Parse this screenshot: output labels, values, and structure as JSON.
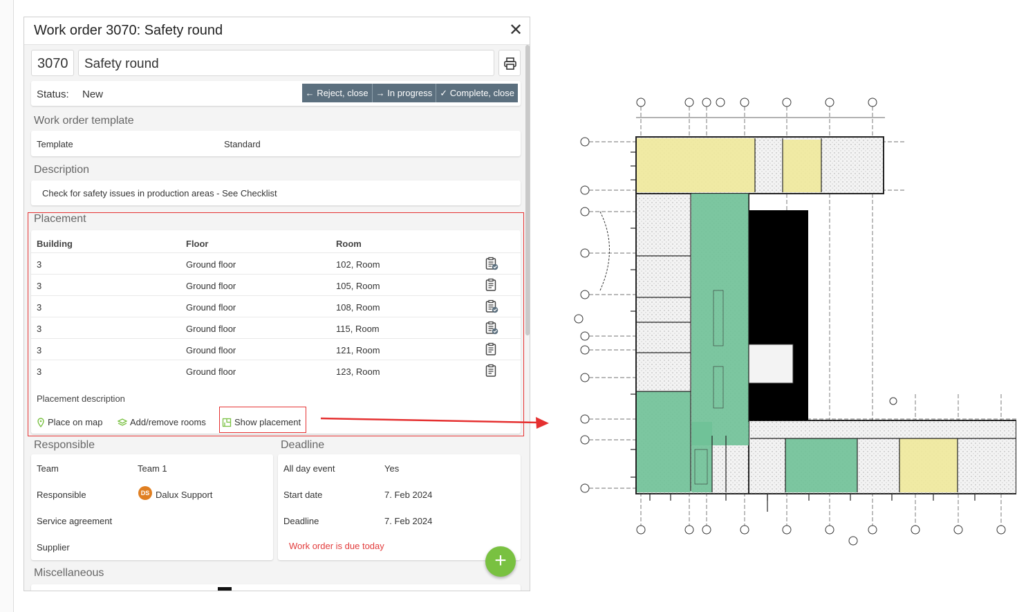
{
  "window": {
    "title": "Work order 3070: Safety round",
    "close_icon": "close-icon"
  },
  "order": {
    "id": "3070",
    "name": "Safety round"
  },
  "status": {
    "label": "Status:",
    "value": "New",
    "actions": [
      "← Reject, close",
      "→ In progress",
      "✓ Complete, close"
    ]
  },
  "template": {
    "section": "Work order template",
    "label": "Template",
    "value": "Standard"
  },
  "description": {
    "section": "Description",
    "text": "Check for safety issues in production areas - See Checklist"
  },
  "placement": {
    "section": "Placement",
    "headers": [
      "Building",
      "Floor",
      "Room"
    ],
    "rows": [
      {
        "building": "3",
        "floor": "Ground floor",
        "room": "102, Room",
        "checked": true
      },
      {
        "building": "3",
        "floor": "Ground floor",
        "room": "105, Room",
        "checked": false
      },
      {
        "building": "3",
        "floor": "Ground floor",
        "room": "108, Room",
        "checked": true
      },
      {
        "building": "3",
        "floor": "Ground floor",
        "room": "115, Room",
        "checked": true
      },
      {
        "building": "3",
        "floor": "Ground floor",
        "room": "121, Room",
        "checked": false
      },
      {
        "building": "3",
        "floor": "Ground floor",
        "room": "123, Room",
        "checked": false
      }
    ],
    "description_label": "Placement description",
    "links": [
      "Place on map",
      "Add/remove rooms",
      "Show placement"
    ]
  },
  "responsible": {
    "section": "Responsible",
    "team_label": "Team",
    "team_value": "Team 1",
    "responsible_label": "Responsible",
    "responsible_initials": "DS",
    "responsible_value": "Dalux Support",
    "service_label": "Service agreement",
    "supplier_label": "Supplier"
  },
  "deadline": {
    "section": "Deadline",
    "allday_label": "All day event",
    "allday_value": "Yes",
    "start_label": "Start date",
    "start_value": "7. Feb 2024",
    "deadline_label": "Deadline",
    "deadline_value": "7. Feb 2024",
    "due_text": "Work order is due today"
  },
  "misc": {
    "section": "Miscellaneous"
  },
  "fab": {
    "label": "+"
  },
  "colors": {
    "accent": "#79c141",
    "action_bg": "#5b6f7e",
    "highlight": "#e53030",
    "room_yellow": "#efe99b",
    "room_green": "#6fc197"
  }
}
